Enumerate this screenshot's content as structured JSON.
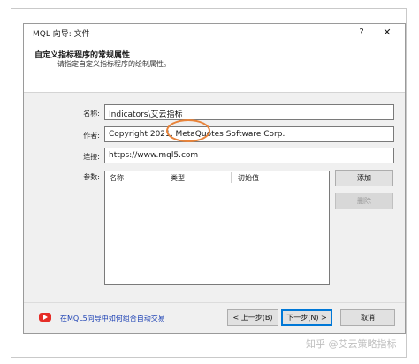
{
  "window": {
    "title": "MQL 向导: 文件",
    "help_label": "?",
    "close_label": "✕"
  },
  "header": {
    "title": "自定义指标程序的常规属性",
    "subtitle": "请指定自定义指标程序的绘制属性。"
  },
  "form": {
    "name_label": "名称:",
    "name_value": "Indicators\\艾云指标",
    "author_label": "作者:",
    "author_value": "Copyright 2021, MetaQuotes Software Corp.",
    "link_label": "连接:",
    "link_value": "https://www.mql5.com",
    "params_label": "参数:"
  },
  "params_table": {
    "columns": [
      "名称",
      "类型",
      "初始值"
    ],
    "rows": []
  },
  "side_buttons": {
    "add": "添加",
    "delete": "删除"
  },
  "footer": {
    "link_text": "在MQL5向导中如何组合自动交易",
    "back": "< 上一步(B)",
    "next": "下一步(N) >",
    "cancel": "取消"
  },
  "watermark": "知乎 @艾云策略指标",
  "colors": {
    "accent": "#0078d7",
    "highlight_circle": "#e8833a",
    "youtube_red": "#e52d27",
    "link": "#1a3fb3"
  },
  "icons": [
    "help-icon",
    "close-icon",
    "youtube-icon"
  ]
}
